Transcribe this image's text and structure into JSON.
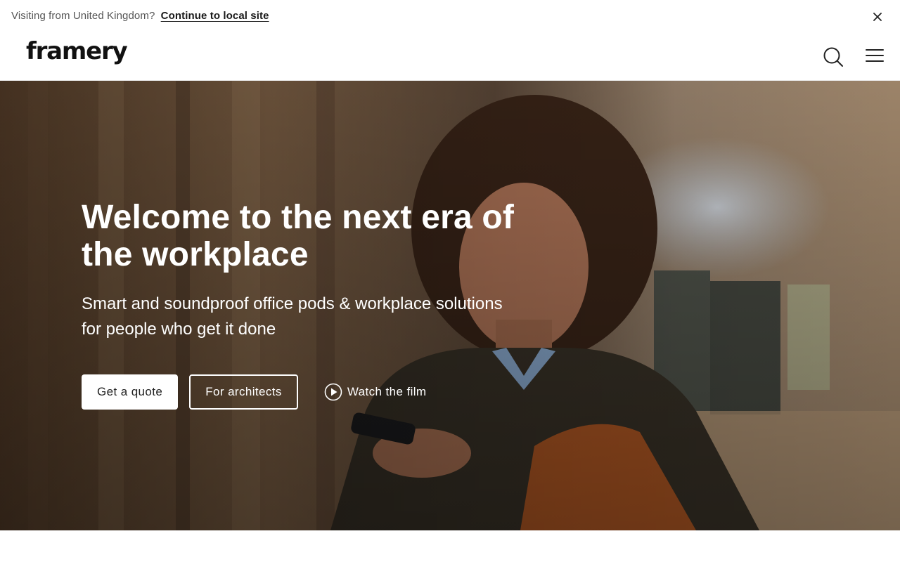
{
  "locale_banner": {
    "text": "Visiting from United Kingdom?",
    "link_label": "Continue to local site",
    "close_icon": "close-icon"
  },
  "header": {
    "logo_text": "framery",
    "search_icon": "search-icon",
    "menu_icon": "hamburger-menu-icon"
  },
  "hero": {
    "title": "Welcome to the next era of the workplace",
    "subtitle": "Smart and soundproof office pods & workplace solutions for people who get it done",
    "primary_button": "Get a quote",
    "secondary_button": "For architects",
    "film_link": "Watch the film",
    "play_icon": "play-circle-icon"
  },
  "colors": {
    "text_dark": "#1a1a1a",
    "text_muted": "#555555",
    "hero_text": "#ffffff"
  }
}
